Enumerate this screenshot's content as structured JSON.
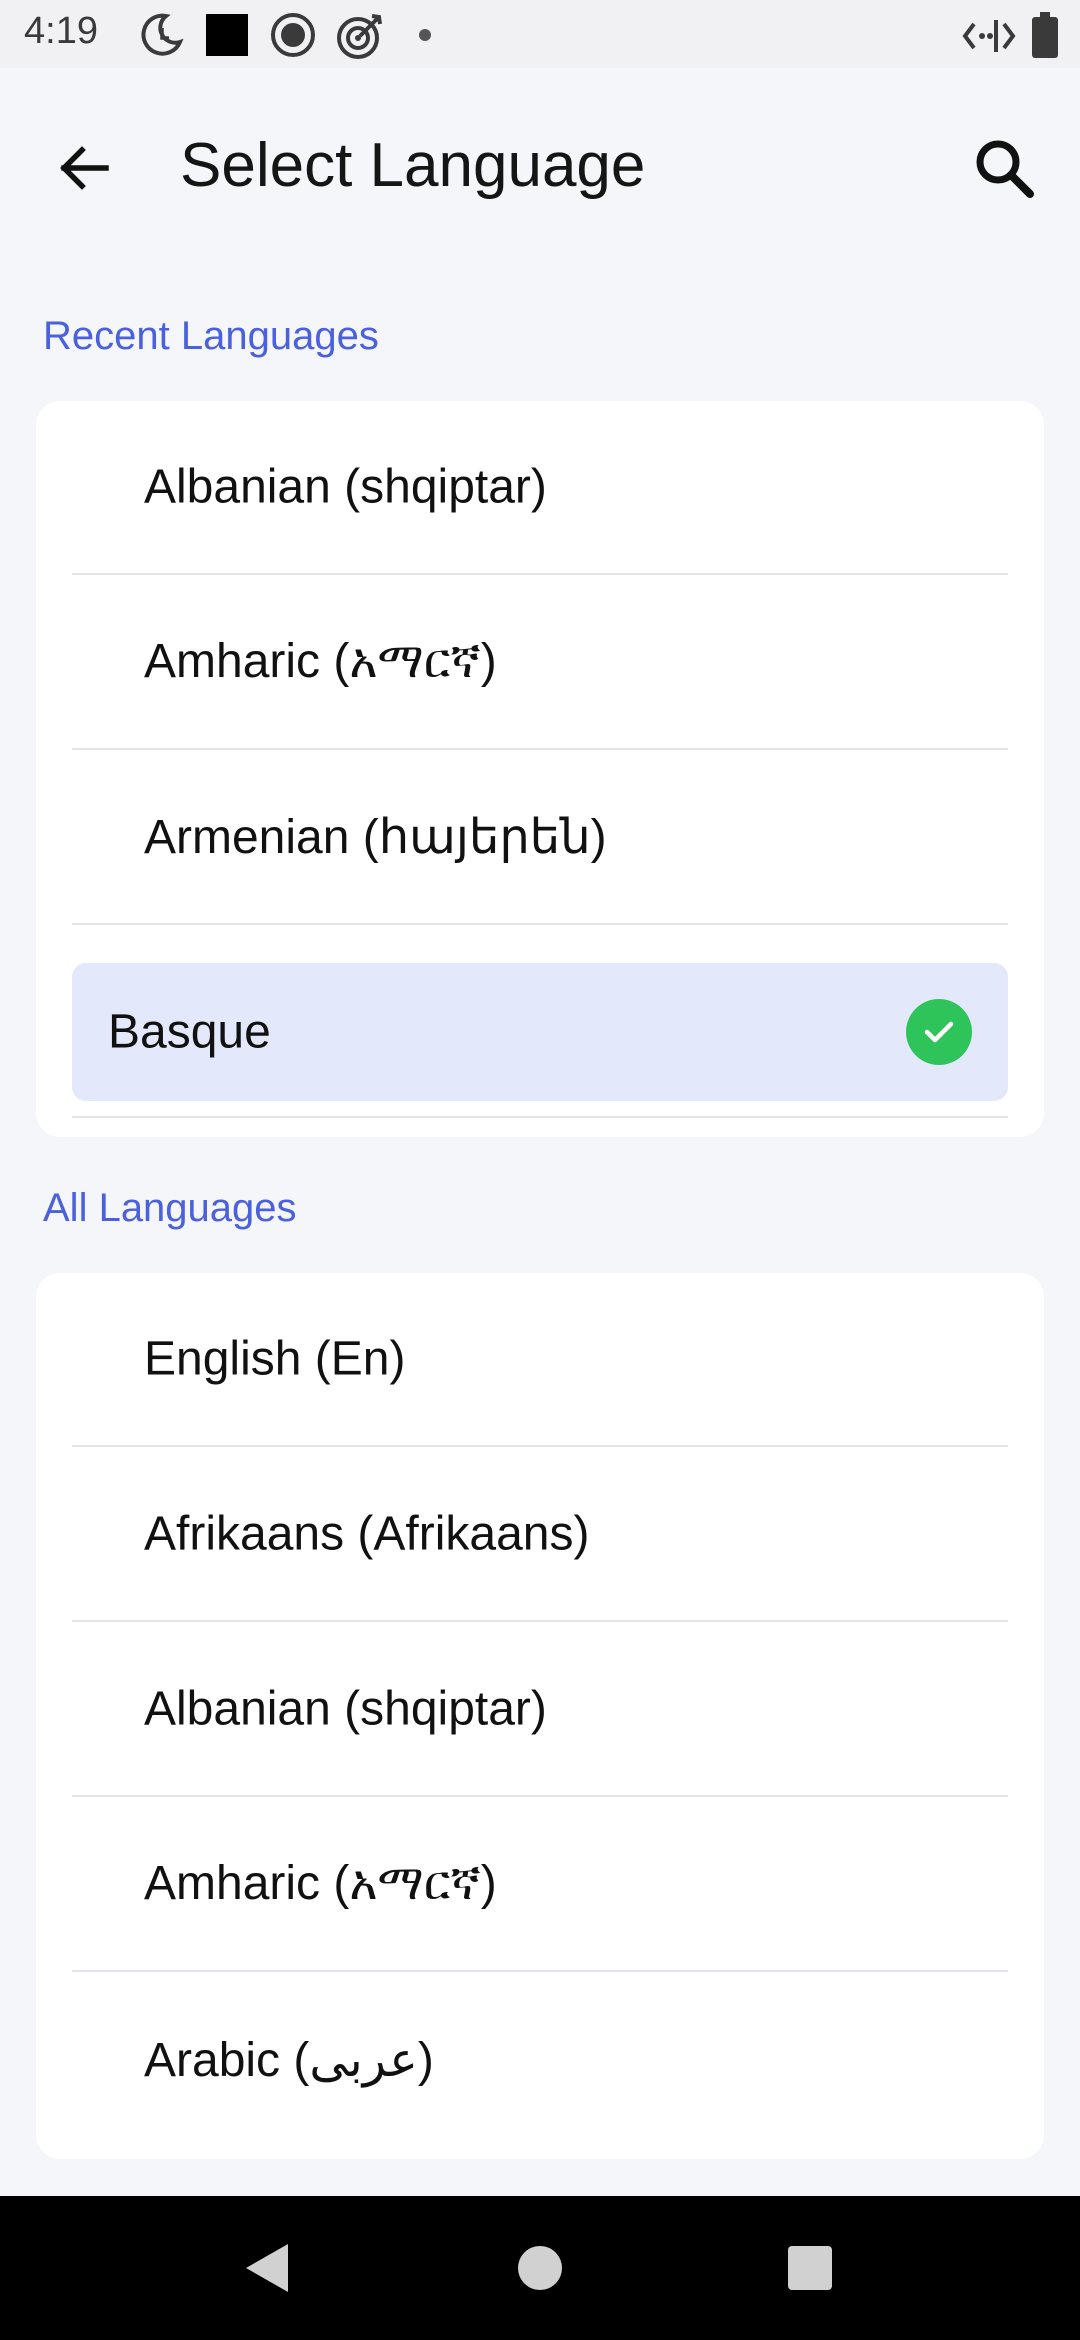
{
  "status_bar": {
    "time": "4:19"
  },
  "header": {
    "title": "Select Language"
  },
  "recent": {
    "heading": "Recent Languages",
    "items": [
      {
        "label": "Albanian (shqiptar)"
      },
      {
        "label": "Amharic (አማርኛ)"
      },
      {
        "label": "Armenian (հայերեն)"
      },
      {
        "label": "Basque",
        "selected": true
      }
    ]
  },
  "all": {
    "heading": "All Languages",
    "items": [
      {
        "label": "English (En)"
      },
      {
        "label": "Afrikaans (Afrikaans)"
      },
      {
        "label": "Albanian (shqiptar)"
      },
      {
        "label": "Amharic (አማርኛ)"
      },
      {
        "label": "Arabic (عربى)"
      }
    ]
  },
  "colors": {
    "accent": "#4b60dc",
    "selected_bg": "#e3e9fb",
    "check": "#2fc45a"
  }
}
